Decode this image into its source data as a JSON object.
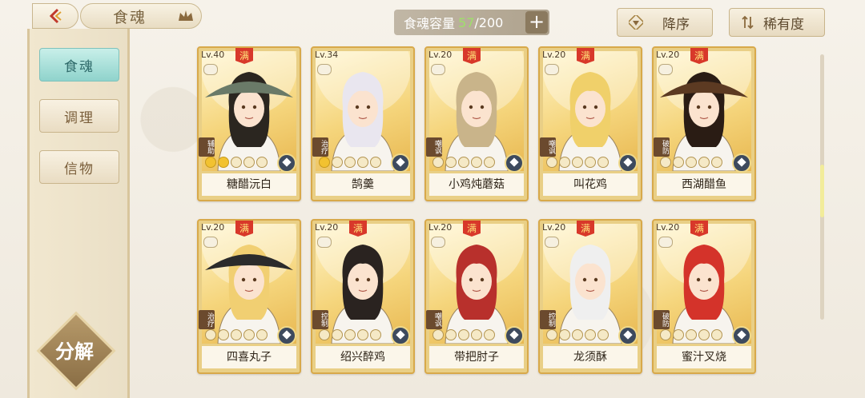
{
  "header": {
    "title": "食魂",
    "capacity_label": "食魂容量",
    "capacity_current": "57",
    "capacity_max": "/200",
    "add_label": "+",
    "sort_order_label": "降序",
    "sort_by_label": "稀有度"
  },
  "sidebar": {
    "items": [
      {
        "label": "食魂",
        "active": true
      },
      {
        "label": "调理",
        "active": false
      },
      {
        "label": "信物",
        "active": false
      }
    ],
    "decompose_label": "分解"
  },
  "cards": [
    {
      "level": "Lv.40",
      "max": "满",
      "type": "辅助",
      "name": "糖醋沅白",
      "stars": 2,
      "hair": "#2b2620",
      "hat": "#6a7a68"
    },
    {
      "level": "Lv.34",
      "max": "",
      "type": "治疗",
      "name": "鹄羹",
      "stars": 1,
      "hair": "#e9e6ef",
      "hat": ""
    },
    {
      "level": "Lv.20",
      "max": "满",
      "type": "嘲讽",
      "name": "小鸡炖蘑菇",
      "stars": 0,
      "hair": "#c9b48a",
      "hat": ""
    },
    {
      "level": "Lv.20",
      "max": "满",
      "type": "嘲讽",
      "name": "叫花鸡",
      "stars": 0,
      "hair": "#f0d06a",
      "hat": ""
    },
    {
      "level": "Lv.20",
      "max": "满",
      "type": "破防",
      "name": "西湖醋鱼",
      "stars": 0,
      "hair": "#2a1c14",
      "hat": "#5c3a22"
    },
    {
      "level": "Lv.20",
      "max": "满",
      "type": "治疗",
      "name": "四喜丸子",
      "stars": 0,
      "hair": "#f1cf72",
      "hat": "#2b2b2b"
    },
    {
      "level": "Lv.20",
      "max": "满",
      "type": "控制",
      "name": "绍兴醉鸡",
      "stars": 0,
      "hair": "#2a2320",
      "hat": ""
    },
    {
      "level": "Lv.20",
      "max": "满",
      "type": "嘲讽",
      "name": "带把肘子",
      "stars": 0,
      "hair": "#b8302c",
      "hat": ""
    },
    {
      "level": "Lv.20",
      "max": "满",
      "type": "控制",
      "name": "龙须酥",
      "stars": 0,
      "hair": "#efefef",
      "hat": ""
    },
    {
      "level": "Lv.20",
      "max": "满",
      "type": "破防",
      "name": "蜜汁叉烧",
      "stars": 0,
      "hair": "#d4332a",
      "hat": ""
    }
  ]
}
